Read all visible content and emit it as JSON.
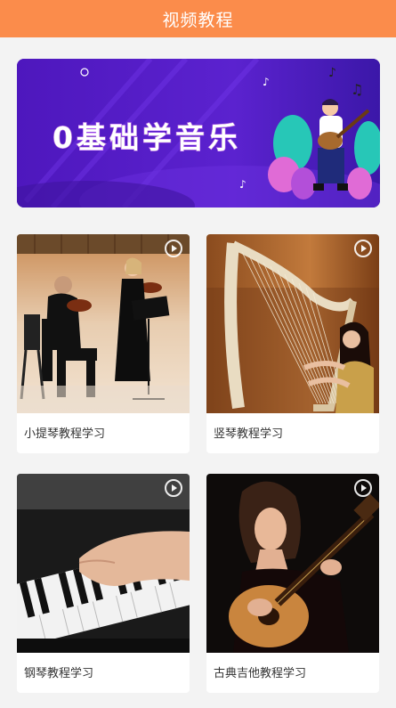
{
  "header": {
    "title": "视频教程"
  },
  "banner": {
    "title": "0基础学音乐"
  },
  "courses": [
    {
      "label": "小提琴教程学习"
    },
    {
      "label": "竖琴教程学习"
    },
    {
      "label": "钢琴教程学习"
    },
    {
      "label": "古典吉他教程学习"
    }
  ],
  "colors": {
    "header": "#fb8c4b",
    "banner": "#5a1fc8",
    "background": "#f3f3f3"
  }
}
